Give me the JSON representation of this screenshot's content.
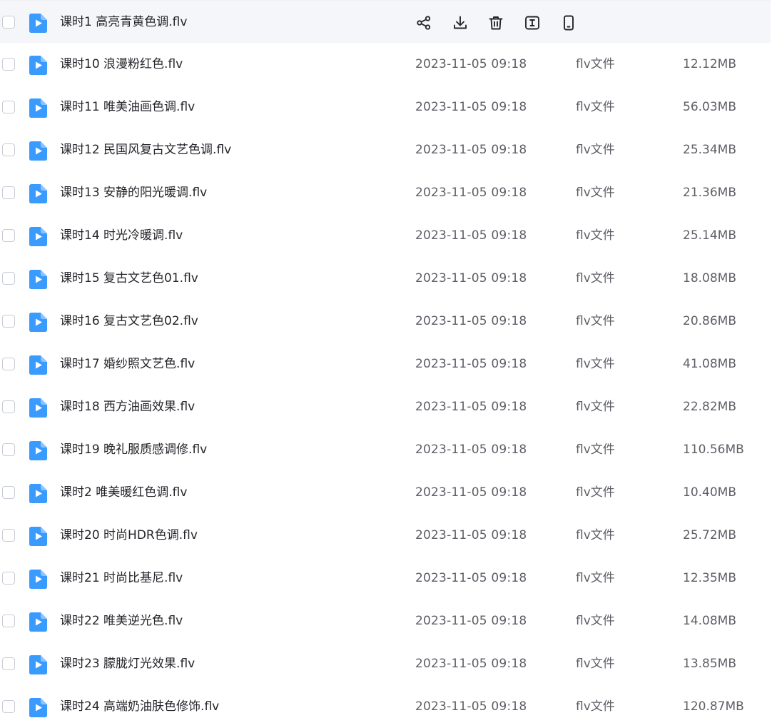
{
  "file_type_icon": "play-video-file-icon",
  "accent_color": "#3a9bff",
  "row_actions": [
    {
      "name": "share-icon",
      "label": "share"
    },
    {
      "name": "download-icon",
      "label": "download"
    },
    {
      "name": "delete-icon",
      "label": "delete"
    },
    {
      "name": "rename-icon",
      "label": "rename"
    },
    {
      "name": "send-to-phone-icon",
      "label": "phone"
    }
  ],
  "files": [
    {
      "name": "课时1 高亮青黄色调.flv",
      "modified": "",
      "type": "",
      "size": "",
      "hovered": true
    },
    {
      "name": "课时10 浪漫粉红色.flv",
      "modified": "2023-11-05 09:18",
      "type": "flv文件",
      "size": "12.12MB"
    },
    {
      "name": "课时11 唯美油画色调.flv",
      "modified": "2023-11-05 09:18",
      "type": "flv文件",
      "size": "56.03MB"
    },
    {
      "name": "课时12 民国风复古文艺色调.flv",
      "modified": "2023-11-05 09:18",
      "type": "flv文件",
      "size": "25.34MB"
    },
    {
      "name": "课时13 安静的阳光暖调.flv",
      "modified": "2023-11-05 09:18",
      "type": "flv文件",
      "size": "21.36MB"
    },
    {
      "name": "课时14 时光冷暖调.flv",
      "modified": "2023-11-05 09:18",
      "type": "flv文件",
      "size": "25.14MB"
    },
    {
      "name": "课时15 复古文艺色01.flv",
      "modified": "2023-11-05 09:18",
      "type": "flv文件",
      "size": "18.08MB"
    },
    {
      "name": "课时16 复古文艺色02.flv",
      "modified": "2023-11-05 09:18",
      "type": "flv文件",
      "size": "20.86MB"
    },
    {
      "name": "课时17 婚纱照文艺色.flv",
      "modified": "2023-11-05 09:18",
      "type": "flv文件",
      "size": "41.08MB"
    },
    {
      "name": "课时18 西方油画效果.flv",
      "modified": "2023-11-05 09:18",
      "type": "flv文件",
      "size": "22.82MB"
    },
    {
      "name": "课时19 晚礼服质感调修.flv",
      "modified": "2023-11-05 09:18",
      "type": "flv文件",
      "size": "110.56MB"
    },
    {
      "name": "课时2 唯美暖红色调.flv",
      "modified": "2023-11-05 09:18",
      "type": "flv文件",
      "size": "10.40MB"
    },
    {
      "name": "课时20 时尚HDR色调.flv",
      "modified": "2023-11-05 09:18",
      "type": "flv文件",
      "size": "25.72MB"
    },
    {
      "name": "课时21 时尚比基尼.flv",
      "modified": "2023-11-05 09:18",
      "type": "flv文件",
      "size": "12.35MB"
    },
    {
      "name": "课时22 唯美逆光色.flv",
      "modified": "2023-11-05 09:18",
      "type": "flv文件",
      "size": "14.08MB"
    },
    {
      "name": "课时23 朦胧灯光效果.flv",
      "modified": "2023-11-05 09:18",
      "type": "flv文件",
      "size": "13.85MB"
    },
    {
      "name": "课时24 高端奶油肤色修饰.flv",
      "modified": "2023-11-05 09:18",
      "type": "flv文件",
      "size": "120.87MB"
    }
  ]
}
